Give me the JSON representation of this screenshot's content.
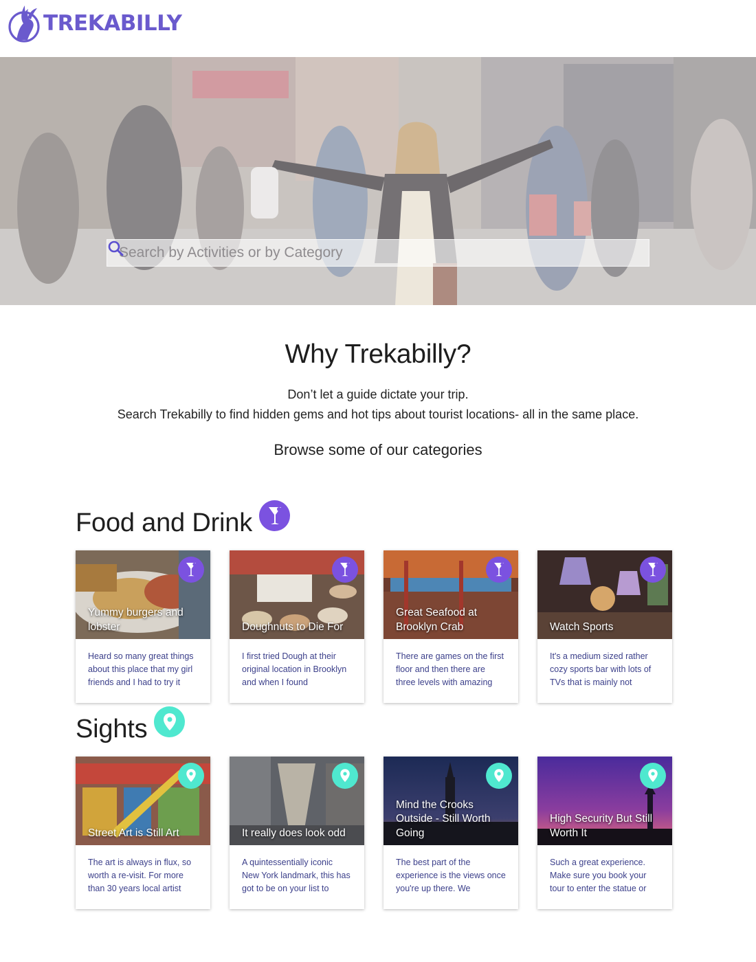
{
  "brand": {
    "name": "TREKABILLY",
    "color": "#6a5acd"
  },
  "search": {
    "placeholder": "Search by Activities or by Category",
    "icon": "search-icon"
  },
  "why": {
    "title": "Why Trekabilly?",
    "line1": "Don’t let a guide dictate your trip.",
    "line2": "Search Trekabilly to find hidden gems and hot tips about tourist locations- all in the same place.",
    "browse": "Browse some of our categories"
  },
  "categories": [
    {
      "title": "Food and Drink",
      "icon": "cocktail-icon",
      "color": "#7b52e0",
      "cards": [
        {
          "title": "Yummy burgers and lobster",
          "text": "Heard so many great things about this place that my girl friends and I had to try it"
        },
        {
          "title": "Doughnuts to Die For",
          "text": "I first tried Dough at their original location in Brooklyn and when I found"
        },
        {
          "title": "Great Seafood at Brooklyn Crab",
          "text": "There are games on the first floor and then there are three levels with amazing"
        },
        {
          "title": "Watch Sports",
          "text": "It's a medium sized rather cozy sports bar with lots of TVs that is mainly not"
        }
      ]
    },
    {
      "title": "Sights",
      "icon": "map-pin-icon",
      "color": "#4fe8cf",
      "cards": [
        {
          "title": "Street Art is Still Art",
          "text": "The art is always in flux, so worth a re-visit. For more than 30 years local artist"
        },
        {
          "title": "It really does look odd",
          "text": "A quintessentially iconic New York landmark, this has got to be on your list to"
        },
        {
          "title": "Mind the Crooks Outside - Still Worth Going",
          "text": "The best part of the experience is the views once you're up there. We"
        },
        {
          "title": "High Security But Still Worth It",
          "text": "Such a great experience. Make sure you book your tour to enter the statue or"
        }
      ]
    }
  ]
}
